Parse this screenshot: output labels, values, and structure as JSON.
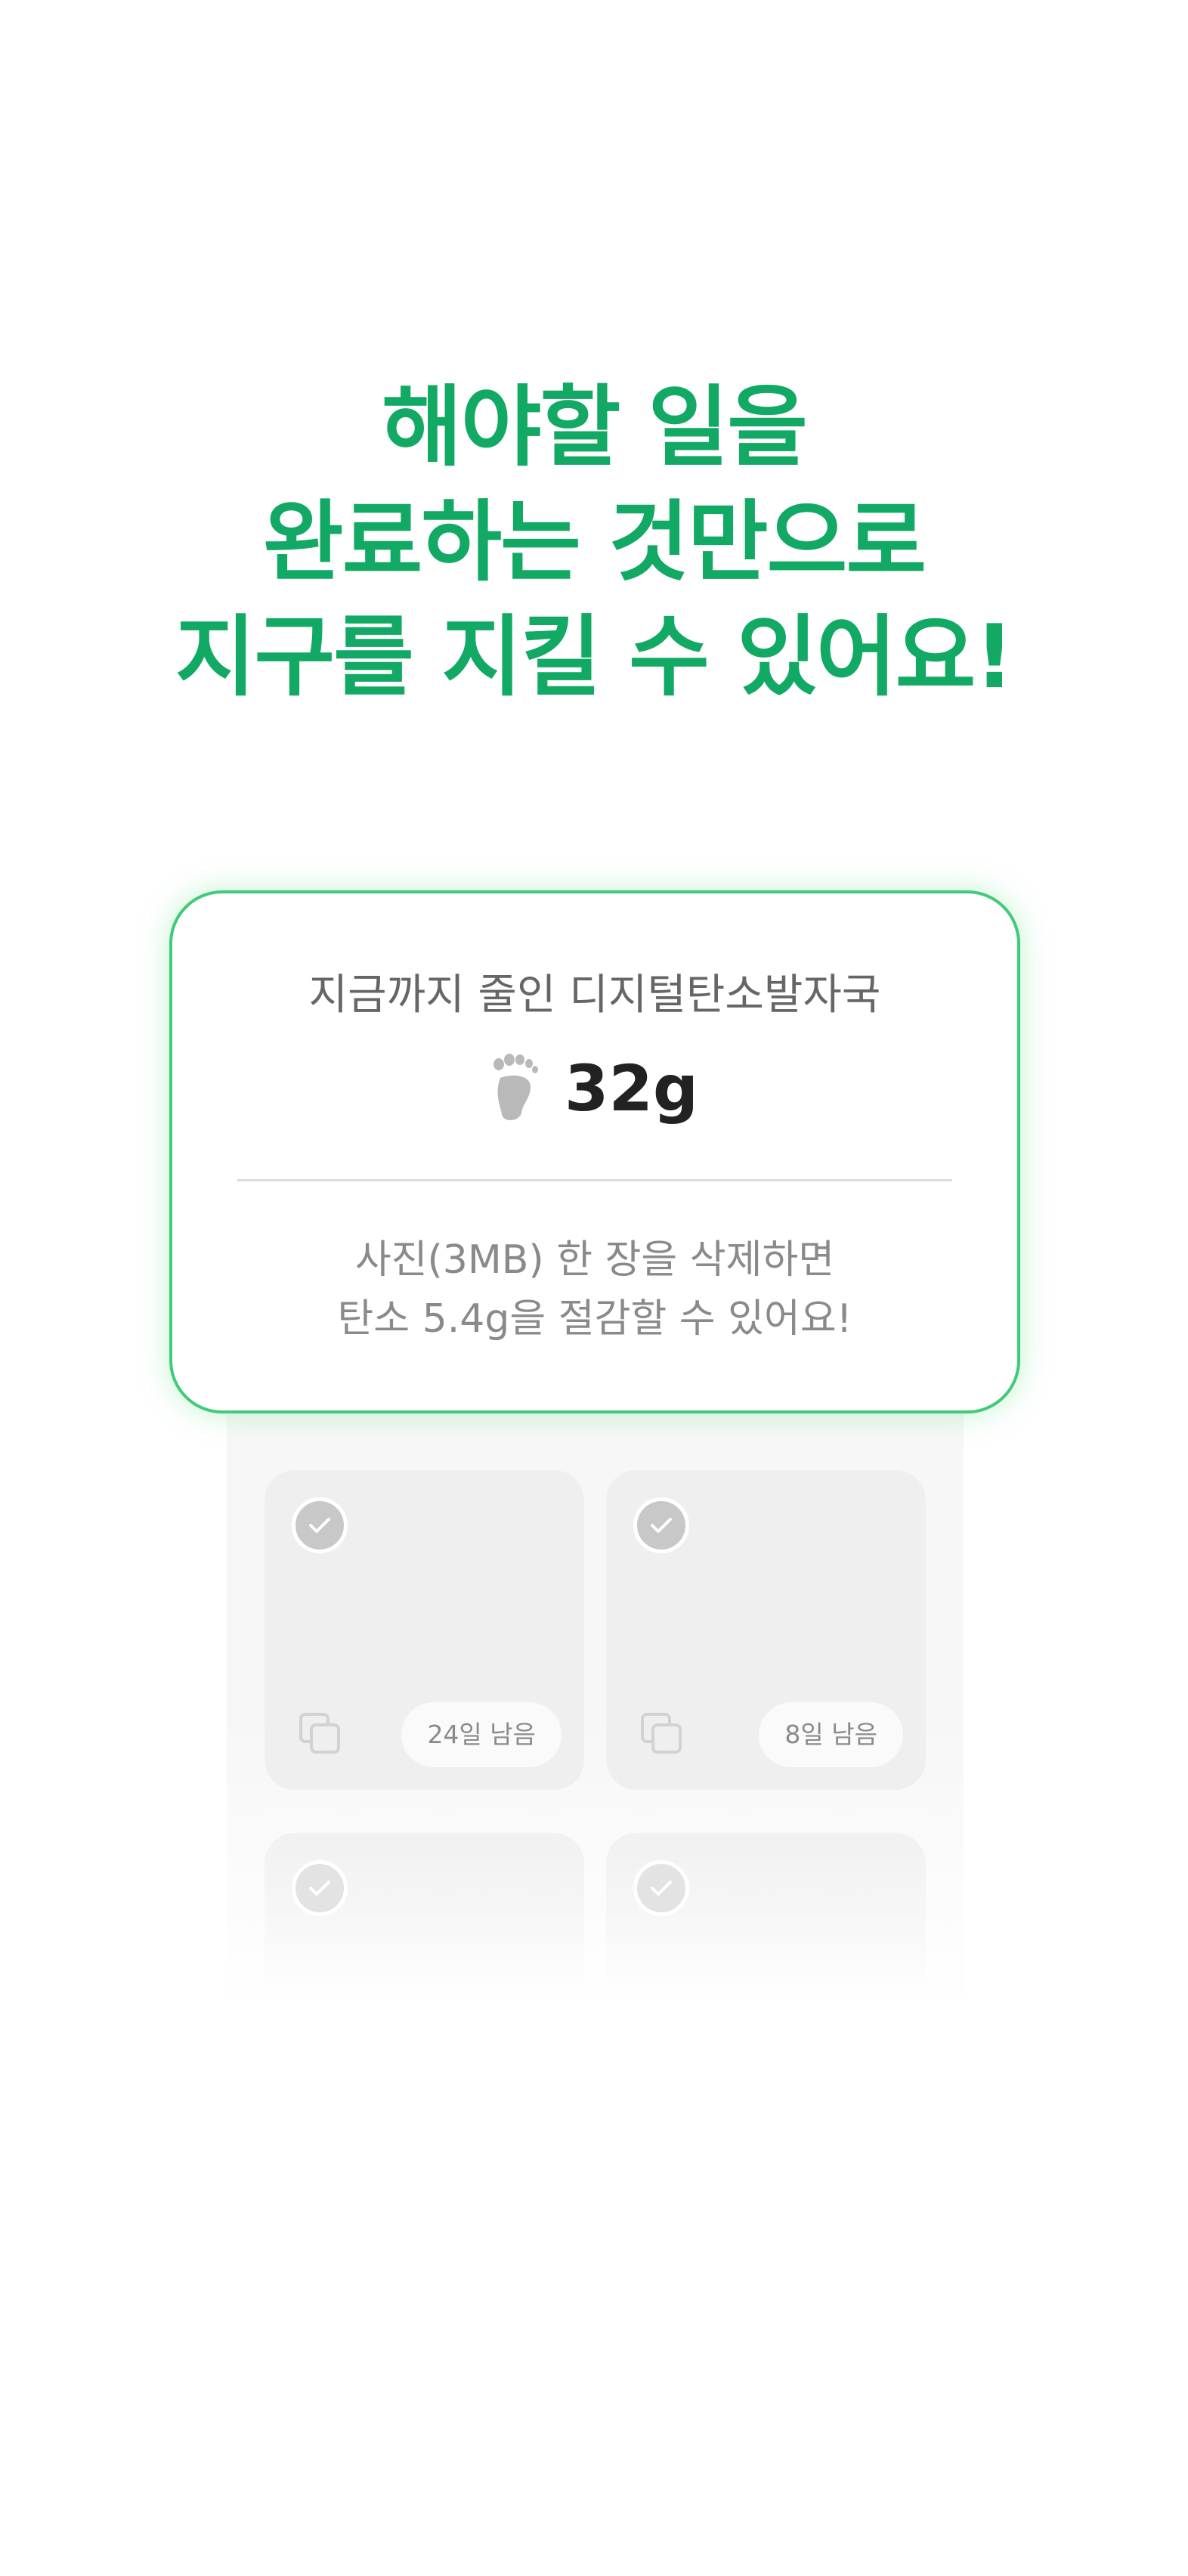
{
  "headline": {
    "line1": "해야할 일을",
    "line2": "완료하는 것만으로",
    "line3": "지구를 지킬 수 있어요!"
  },
  "info_card": {
    "label": "지금까지 줄인 디지털탄소발자국",
    "footprint_icon": "footprint-icon",
    "value": "32g",
    "description_line1": "사진(3MB) 한 장을 삭제하면",
    "description_line2": "탄소 5.4g을 절감할 수 있어요!"
  },
  "photo_tiles": [
    {
      "days_left": "24일 남음",
      "check_icon": "check-circle-icon",
      "stack_icon": "copy-stack-icon"
    },
    {
      "days_left": "8일 남음",
      "check_icon": "check-circle-icon",
      "stack_icon": "copy-stack-icon"
    }
  ],
  "colors": {
    "accent_green": "#12a965",
    "card_border": "#3ecb7b",
    "text_dark": "#222222",
    "text_gray": "#8a8a8a"
  }
}
